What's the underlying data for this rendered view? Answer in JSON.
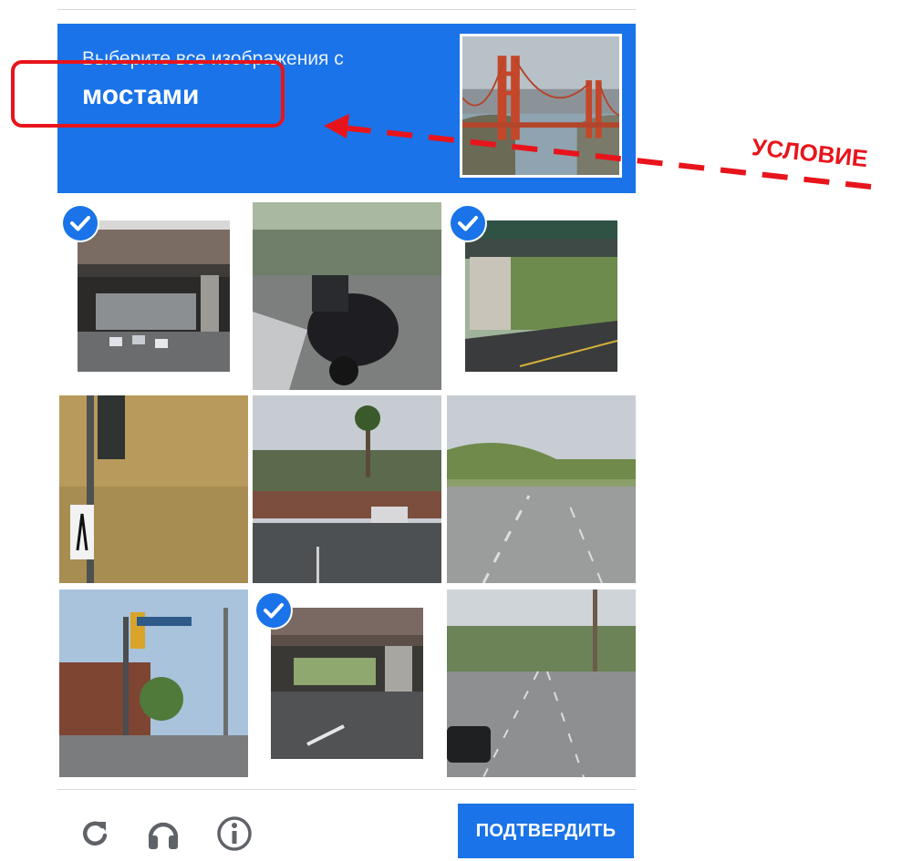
{
  "captcha": {
    "instruction": "Выберите все изображения с",
    "keyword": "мостами",
    "sample_image": "golden-gate-bridge"
  },
  "tiles": [
    {
      "id": 1,
      "subject": "highway overpass underside",
      "selected": true
    },
    {
      "id": 2,
      "subject": "covered motorcycle by hedge",
      "selected": false
    },
    {
      "id": 3,
      "subject": "green bridge over road",
      "selected": true
    },
    {
      "id": 4,
      "subject": "traffic light on grass field",
      "selected": false
    },
    {
      "id": 5,
      "subject": "palm trees and street",
      "selected": false
    },
    {
      "id": 6,
      "subject": "empty road with hills",
      "selected": false
    },
    {
      "id": 7,
      "subject": "intersection with traffic light",
      "selected": false
    },
    {
      "id": 8,
      "subject": "overpass over road",
      "selected": true
    },
    {
      "id": 9,
      "subject": "multi-lane street with car",
      "selected": false
    }
  ],
  "footer": {
    "reload_icon": "reload-icon",
    "audio_icon": "headphones-icon",
    "info_icon": "info-icon",
    "verify_label": "ПОДТВЕРДИТЬ"
  },
  "annotation": {
    "label": "УСЛОВИЕ",
    "color": "#e8141c"
  },
  "colors": {
    "accent": "#1a73e8",
    "annotation": "#e8141c"
  }
}
